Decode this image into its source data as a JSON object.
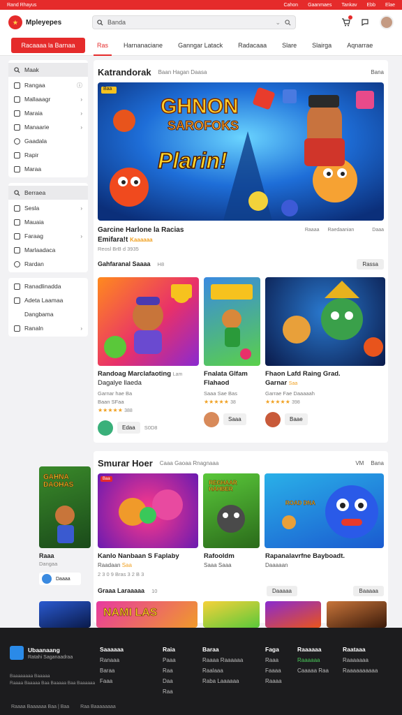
{
  "topbar": {
    "left": "Rand Rhayus",
    "right": [
      "Cahon",
      "Gaanmaes",
      "Tankav",
      "Ebb",
      "Elae"
    ]
  },
  "header": {
    "brand": "Mpleyepes",
    "search_placeholder": "Banda"
  },
  "nav": {
    "cta_label": "Racaaaa la Barnaa",
    "tabs": [
      "Ras",
      "Harnanaciane",
      "Ganngar Latack",
      "Radacaaa",
      "Slare",
      "Slairga",
      "Aqnarrae"
    ]
  },
  "sidebar": {
    "group1_head": "Maak",
    "group1": [
      "Rangaa",
      "Mallaaagr",
      "Maraia",
      "Manaarie",
      "Gaadala",
      "Rapir",
      "Maraa"
    ],
    "group2_head": "Berraea",
    "group2": [
      "Sesla",
      "Mauaia",
      "Faraag",
      "Marlaadaca",
      "Rardan"
    ],
    "group3": [
      "Ranadlinadda",
      "Adeta Laamaa",
      "Dangbama",
      "Ranaln"
    ]
  },
  "featured": {
    "title": "Katrandorak",
    "subtitle": "Baan Hagan Daasa",
    "more": "Bana",
    "hero_badge": "Baa",
    "hero_title_1": "GHNON",
    "hero_title_2": "SAROFOKS",
    "hero_title_3": "Plarin!",
    "game_title": "Garcine Harlone la Racias",
    "game_line2": "Emifara!t",
    "game_line2_badge": "Kaaaaaa",
    "game_meta": "Reosl BrB d 3935",
    "meta_right_1": "Raaaa",
    "meta_right_2": "Raedaanian",
    "meta_right_3": "Daaa"
  },
  "popular": {
    "title": "Gahfaranal Saaaa",
    "count": "H8",
    "more": "Rassa",
    "games": [
      {
        "title": "Randoag Marclafaoting",
        "title2": "Dagalye llaeda",
        "tag": "Lam",
        "meta": "Garnar hae Ba",
        "meta2": "Baan SFaa",
        "rating": "4.8",
        "count": "388",
        "author": "Edaa",
        "author_meta": "S0D8"
      },
      {
        "title": "Fnalata Glfam",
        "title2": "Flahaod",
        "tag": "",
        "meta": "Saaa Sae Bas",
        "meta2": "",
        "rating": "4.5",
        "count": "38",
        "author": "Saaa",
        "author_meta": ""
      },
      {
        "title": "Fhaon Lafd Raing Grad.",
        "title2": "Garnar",
        "tag": "Saa",
        "meta": "Garrae Fae Daaaaah",
        "meta2": "",
        "rating": "4.7",
        "count": "398",
        "author": "Baae",
        "author_meta": ""
      }
    ]
  },
  "section2": {
    "title": "Smurar Hoer",
    "subtitle": "Caaa Gaoaa Rnagnaaa",
    "more": "Bana",
    "count": "VM",
    "side_game": {
      "title": "Raaa",
      "meta": "Dangaa",
      "author": "Daaaa"
    },
    "side_thumb_text": "GAHNA DAOHAS",
    "thumb1_badge": "Baa",
    "thumb2_text": "REGHAAR HAHBER",
    "thumb3_text": "ROAD DNA",
    "row_title": "Kanlo Nanbaan S Faplaby",
    "row_title_mid": "Rafooldm",
    "row_title_right": "Rapanalavrfne Bayboadt.",
    "row_meta_left": "Raadaan",
    "row_meta_left_badge": "Saa",
    "row_meta_right": "Daaaaan",
    "row_meta_mid": "Saaa Saaa",
    "row_date": "2 3 0 9 Bras 3 2 B 3",
    "sub_title": "Graaa Laraaaaa",
    "sub_count": "10",
    "sub_more": "Daaaaa",
    "sub_more_2": "Baaaaa",
    "bottom_thumb_text": "NAMI LAS"
  },
  "footer": {
    "brand": "Ubaanaang",
    "brand_sub": "Ratahi Saganaadraa",
    "col1": {
      "head": "Saaaaaa",
      "items": [
        "Ranaaa",
        "Baraa",
        "Faaa"
      ]
    },
    "col2": {
      "head": "Raia",
      "items": [
        "Paaa",
        "Raa",
        "Daa",
        "Raa"
      ]
    },
    "col3": {
      "head": "Baraa",
      "items": [
        "Raaaa Raaaaaa",
        "Raalaaa",
        "Raba Laaaaaa"
      ]
    },
    "col4": {
      "head": "Faga",
      "items": [
        "Raaa",
        "Faaaa",
        "Raaaa"
      ]
    },
    "col5": {
      "head": "Raaaaaa",
      "items": [
        "Raaaaaa",
        "Caaaaa Raa"
      ]
    },
    "col6": {
      "head": "Raataaa",
      "items": [
        "Raaaaaaa",
        "Raaaaaaaaaa"
      ]
    },
    "legal": "Baaaaaaaa Baaaaa",
    "legal2": "Raaaa Baaaaa Baa Baaaaa Baa Baaaaaa",
    "copyright": "Raaaa Baaaaaa Baa | Baa",
    "copyright2": "Raa Baaaaaaaa"
  },
  "colors": {
    "accent": "#e52b2b",
    "footer": "#1c1c1e"
  }
}
